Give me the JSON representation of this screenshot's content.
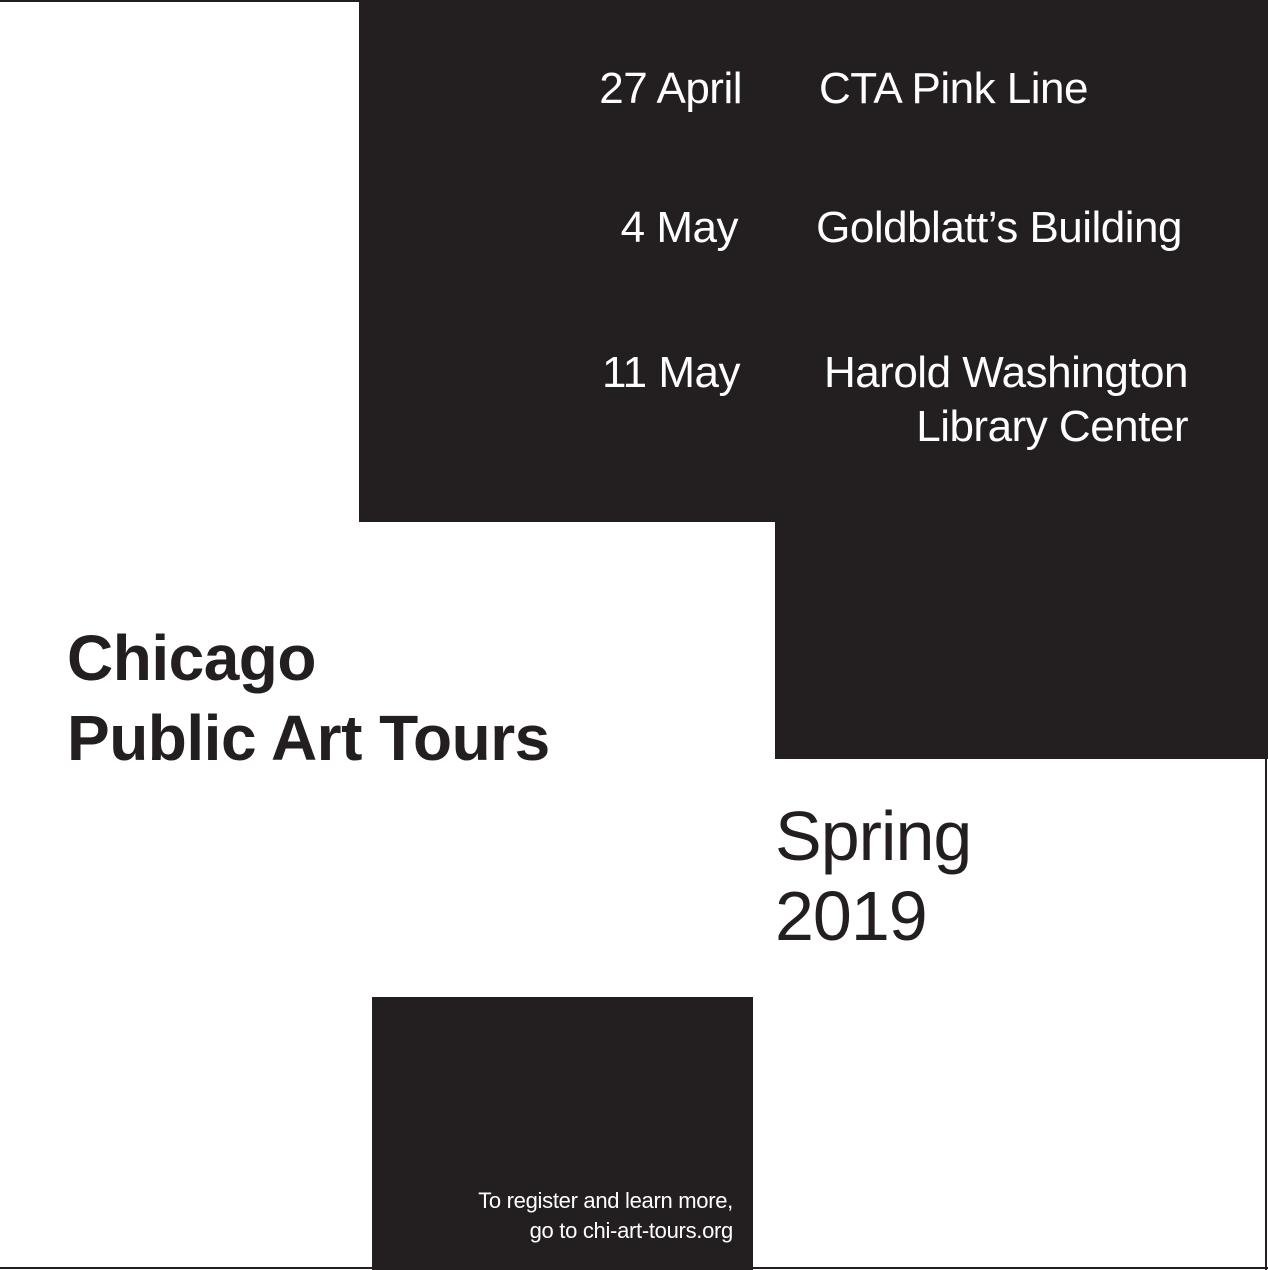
{
  "schedule": {
    "tours": [
      {
        "date": "27 April",
        "venue_lines": [
          "CTA Pink Line"
        ]
      },
      {
        "date": "4 May",
        "venue_lines": [
          "Goldblatt’s Building"
        ]
      },
      {
        "date": "11 May",
        "venue_lines": [
          "Harold Washington",
          "Library Center"
        ]
      }
    ]
  },
  "title": {
    "line1": "Chicago",
    "line2": "Public Art Tours"
  },
  "season": {
    "line1": "Spring",
    "line2": "2019"
  },
  "register": {
    "line1": "To register and learn more,",
    "line2": "go to chi-art-tours.org"
  },
  "colors": {
    "ink": "#231f20",
    "paper": "#ffffff"
  }
}
